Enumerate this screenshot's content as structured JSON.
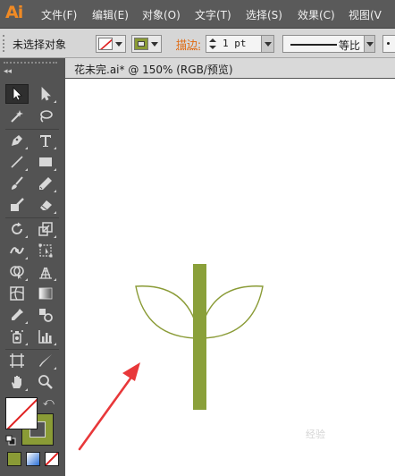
{
  "app": {
    "logo": "Ai"
  },
  "menu": [
    {
      "label": "文件(F)"
    },
    {
      "label": "编辑(E)"
    },
    {
      "label": "对象(O)"
    },
    {
      "label": "文字(T)"
    },
    {
      "label": "选择(S)"
    },
    {
      "label": "效果(C)"
    },
    {
      "label": "视图(V"
    }
  ],
  "control_bar": {
    "selection_status": "未选择对象",
    "stroke_label": "描边:",
    "stroke_weight": "1 pt",
    "stroke_profile": "等比"
  },
  "document": {
    "tab_title": "花未完.ai* @ 150% (RGB/预览)",
    "zoom": "150%",
    "color_mode": "RGB/预览"
  },
  "tools": [
    {
      "name": "selection-tool-icon",
      "selected": true
    },
    {
      "name": "direct-selection-tool-icon"
    },
    {
      "name": "magic-wand-tool-icon"
    },
    {
      "name": "lasso-tool-icon"
    },
    {
      "name": "pen-tool-icon"
    },
    {
      "name": "type-tool-icon"
    },
    {
      "name": "line-segment-tool-icon"
    },
    {
      "name": "rectangle-tool-icon"
    },
    {
      "name": "paintbrush-tool-icon"
    },
    {
      "name": "pencil-tool-icon"
    },
    {
      "name": "blob-brush-tool-icon"
    },
    {
      "name": "eraser-tool-icon"
    },
    {
      "name": "rotate-tool-icon"
    },
    {
      "name": "scale-tool-icon"
    },
    {
      "name": "width-tool-icon"
    },
    {
      "name": "free-transform-tool-icon"
    },
    {
      "name": "shape-builder-tool-icon"
    },
    {
      "name": "perspective-grid-tool-icon"
    },
    {
      "name": "mesh-tool-icon"
    },
    {
      "name": "gradient-tool-icon"
    },
    {
      "name": "eyedropper-tool-icon"
    },
    {
      "name": "blend-tool-icon"
    },
    {
      "name": "symbol-sprayer-tool-icon"
    },
    {
      "name": "column-graph-tool-icon"
    },
    {
      "name": "artboard-tool-icon"
    },
    {
      "name": "slice-tool-icon"
    },
    {
      "name": "hand-tool-icon"
    },
    {
      "name": "zoom-tool-icon"
    }
  ],
  "colors": {
    "fill": "none",
    "stroke": "#8a9b36",
    "artwork_stem": "#8aa03a",
    "artwork_leaf_stroke": "#8a9b36",
    "annotation_arrow": "#e8383a",
    "logo": "#f08a24"
  },
  "watermark": {
    "text": "经验"
  }
}
